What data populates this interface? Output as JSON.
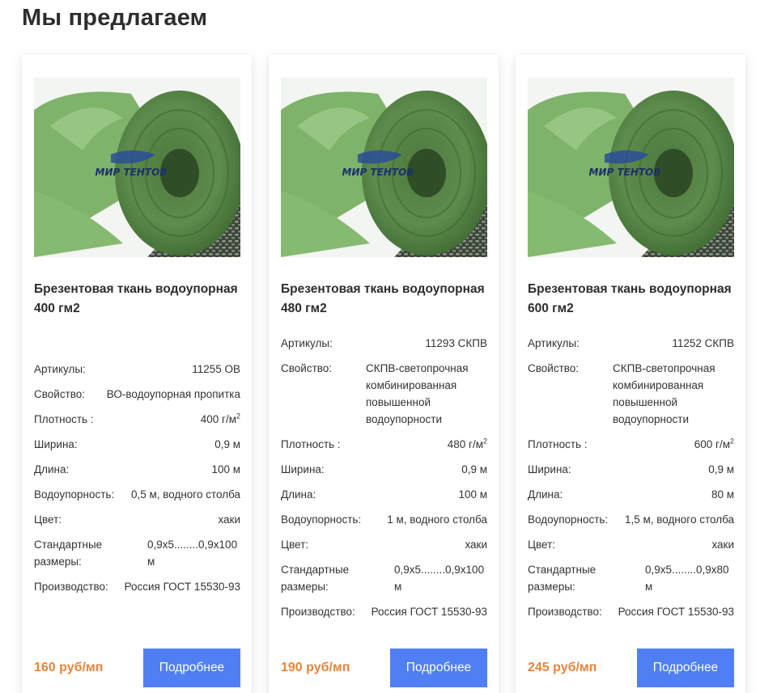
{
  "page": {
    "title": "Мы предлагаем"
  },
  "colors": {
    "price": "#e8843a",
    "button": "#4f7ff2",
    "fabric": "#7fb36a"
  },
  "cards": [
    {
      "title": "Брезентовая ткань водоупорная 400 гм2",
      "image_logo": "МИР ТЕНТОВ",
      "specs": {
        "article_label": "Артикулы:",
        "article": "11255 ОВ",
        "property_label": "Свойство:",
        "property": "ВО-водоупорная пропитка",
        "density_label": "Плотность :",
        "density": "400 г/м",
        "density_sup": "2",
        "width_label": "Ширина:",
        "width": "0,9 м",
        "length_label": "Длина:",
        "length": "100 м",
        "water_label": "Водоупорность:",
        "water": "0,5 м, водного столба",
        "color_label": "Цвет:",
        "color": "хаки",
        "sizes_label": "Стандартные размеры:",
        "sizes": "0,9х5........0,9х100 м",
        "producer_label": "Производство:",
        "producer": "Россия ГОСТ 15530-93"
      },
      "price": "160 руб/мп",
      "button": "Подробнее"
    },
    {
      "title": "Брезентовая ткань водоупорная 480 гм2",
      "image_logo": "МИР ТЕНТОВ",
      "specs": {
        "article_label": "Артикулы:",
        "article": "11293 СКПВ",
        "property_label": "Свойство:",
        "property": "СКПВ-светопрочная комбинированная повышенной водоупорности",
        "density_label": "Плотность :",
        "density": "480 г/м",
        "density_sup": "2",
        "width_label": "Ширина:",
        "width": "0,9 м",
        "length_label": "Длина:",
        "length": "100 м",
        "water_label": "Водоупорность:",
        "water": "1 м, водного столба",
        "color_label": "Цвет:",
        "color": "хаки",
        "sizes_label": "Стандартные размеры:",
        "sizes": "0,9х5........0,9х100 м",
        "producer_label": "Производство:",
        "producer": "Россия ГОСТ 15530-93"
      },
      "price": "190 руб/мп",
      "button": "Подробнее"
    },
    {
      "title": "Брезентовая ткань водоупорная 600 гм2",
      "image_logo": "МИР ТЕНТОВ",
      "specs": {
        "article_label": "Артикулы:",
        "article": "11252 СКПВ",
        "property_label": "Свойство:",
        "property": "СКПВ-светопрочная комбинированная повышенной водоупорности",
        "density_label": "Плотность :",
        "density": "600 г/м",
        "density_sup": "2",
        "width_label": "Ширина:",
        "width": "0,9 м",
        "length_label": "Длина:",
        "length": "80 м",
        "water_label": "Водоупорность:",
        "water": "1,5 м, водного столба",
        "color_label": "Цвет:",
        "color": "хаки",
        "sizes_label": "Стандартные размеры:",
        "sizes": "0,9х5........0,9х80 м",
        "producer_label": "Производство:",
        "producer": "Россия ГОСТ 15530-93"
      },
      "price": "245 руб/мп",
      "button": "Подробнее"
    }
  ]
}
